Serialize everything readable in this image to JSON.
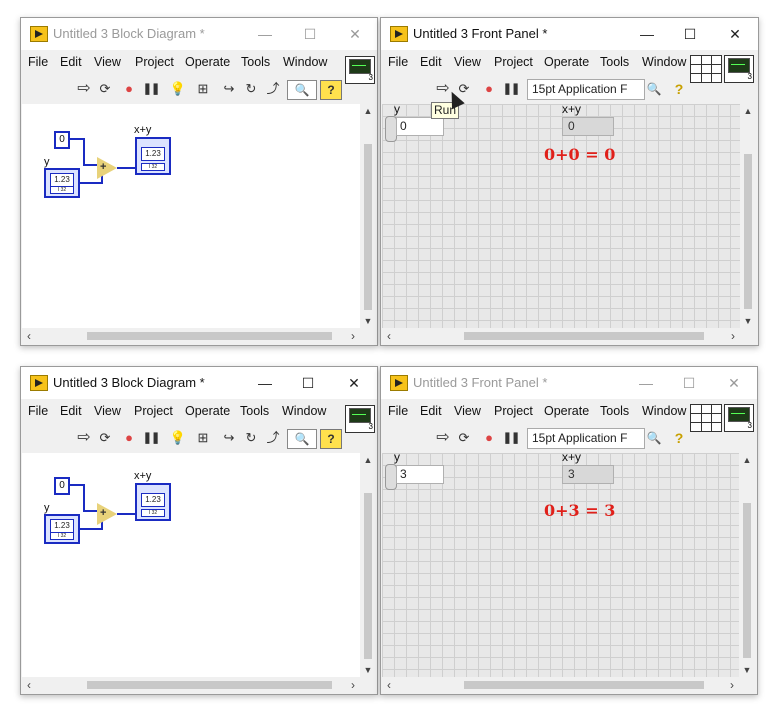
{
  "menu": [
    "File",
    "Edit",
    "View",
    "Project",
    "Operate",
    "Tools",
    "Window"
  ],
  "vi_badge": "3",
  "font_select": "15pt Application F",
  "top_bd": {
    "title": "Untitled 3 Block Diagram *",
    "active": false,
    "label_y": "y",
    "label_sum": "x+y",
    "const_value": "0",
    "terminal_type": "1.23",
    "terminal_tag": "I 32"
  },
  "top_fp": {
    "title": "Untitled 3 Front Panel *",
    "active": true,
    "label_y": "y",
    "label_sum": "x+y",
    "control_value": "0",
    "indicator_value": "0",
    "annotation": "0+0 = 0",
    "tooltip": "Run"
  },
  "bottom_bd": {
    "title": "Untitled 3 Block Diagram *",
    "active": true,
    "label_y": "y",
    "label_sum": "x+y",
    "const_value": "0",
    "terminal_type": "1.23",
    "terminal_tag": "I 32"
  },
  "bottom_fp": {
    "title": "Untitled 3 Front Panel *",
    "active": false,
    "label_y": "y",
    "label_sum": "x+y",
    "control_value": "3",
    "indicator_value": "3",
    "annotation": "0+3 = 3"
  },
  "colors": {
    "wire": "#1a2bc2",
    "annotation": "#e0201a",
    "grid": "#cfcfcf"
  },
  "icons": {
    "run": "run-arrow-icon",
    "run_continuous": "run-continuously-icon",
    "abort": "abort-icon",
    "pause": "pause-icon",
    "highlight": "highlight-execution-icon",
    "retain": "retain-wire-values-icon",
    "step_into": "step-into-icon",
    "step_over": "step-over-icon",
    "step_out": "step-out-icon",
    "search": "search-icon",
    "help": "help-icon"
  }
}
